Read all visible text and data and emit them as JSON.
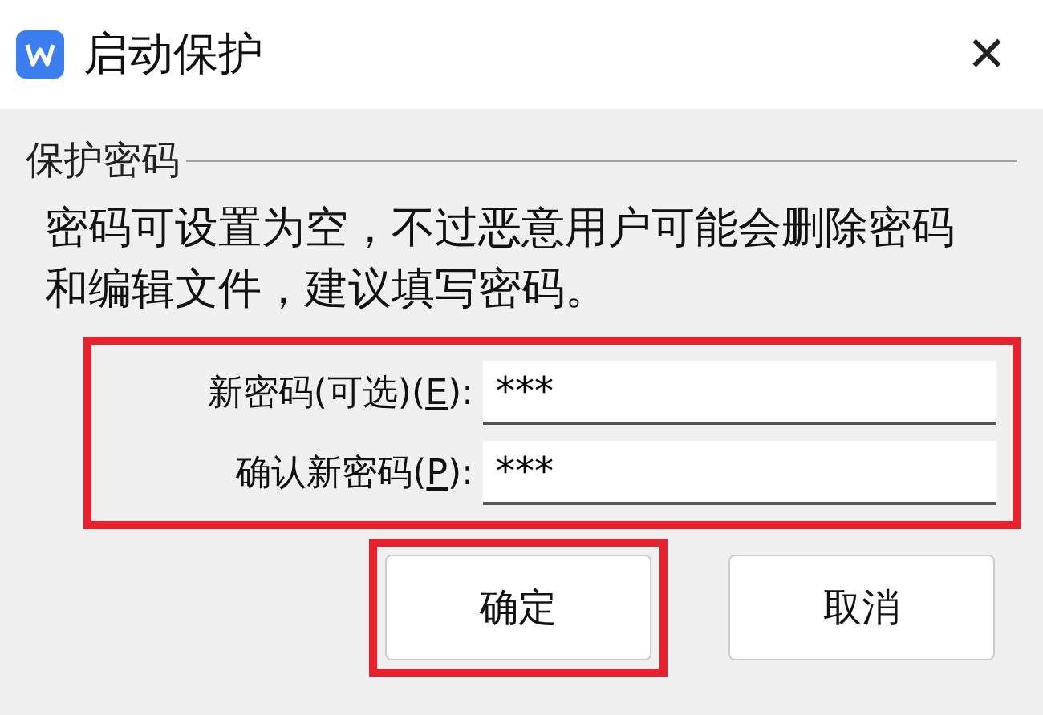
{
  "window": {
    "title": "启动保护",
    "close": "✕"
  },
  "group": {
    "title": "保护密码"
  },
  "message": "密码可设置为空，不过恶意用户可能会删除密码和编辑文件，建议填写密码。",
  "fields_highlighted": true,
  "fields": [
    {
      "label_before": "新密码(可选)(",
      "mnemonic": "E",
      "label_after": "):",
      "value": "***"
    },
    {
      "label_before": "确认新密码(",
      "mnemonic": "P",
      "label_after": "):",
      "value": "***"
    }
  ],
  "buttons": [
    {
      "label": "确定",
      "highlighted": true
    },
    {
      "label": "取消",
      "highlighted": false
    }
  ]
}
